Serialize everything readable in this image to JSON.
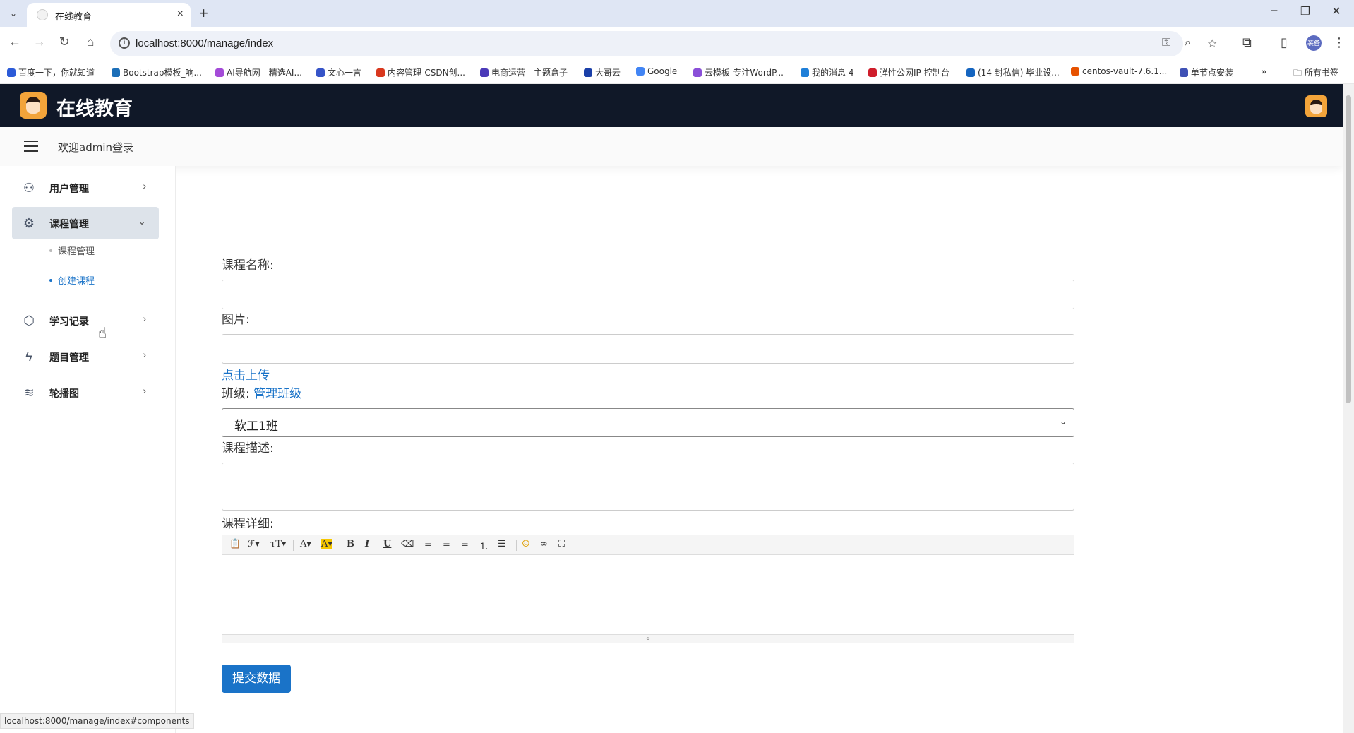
{
  "browser": {
    "tab_title": "在线教育",
    "url": "localhost:8000/manage/index",
    "bookmarks": [
      "百度一下，你就知道",
      "Bootstrap模板_响...",
      "AI导航网 - 精选AI...",
      "文心一言",
      "内容管理-CSDN创...",
      "电商运营 - 主题盒子",
      "大哥云",
      "Google",
      "云模板-专注WordP...",
      "我的消息 4",
      "弹性公网IP-控制台",
      "(14 封私信) 毕业设...",
      "centos-vault-7.6.1...",
      "单节点安装"
    ],
    "all_bookmarks": "所有书签",
    "profile_label": "装备",
    "status_url": "localhost:8000/manage/index#components"
  },
  "header": {
    "brand": "在线教育",
    "welcome": "欢迎admin登录"
  },
  "sidebar": {
    "items": [
      {
        "label": "用户管理",
        "icon": "users-icon"
      },
      {
        "label": "课程管理",
        "icon": "cpu-icon"
      },
      {
        "label": "学习记录",
        "icon": "box-icon"
      },
      {
        "label": "题目管理",
        "icon": "zap-icon"
      },
      {
        "label": "轮播图",
        "icon": "layers-icon"
      }
    ],
    "sub_items": [
      "课程管理",
      "创建课程"
    ]
  },
  "form": {
    "course_name_label": "课程名称:",
    "image_label": "图片:",
    "upload_link": "点击上传",
    "class_label": "班级:",
    "manage_class_link": "管理班级",
    "class_selected": "软工1班",
    "description_label": "课程描述:",
    "detail_label": "课程详细:",
    "submit_label": "提交数据"
  }
}
